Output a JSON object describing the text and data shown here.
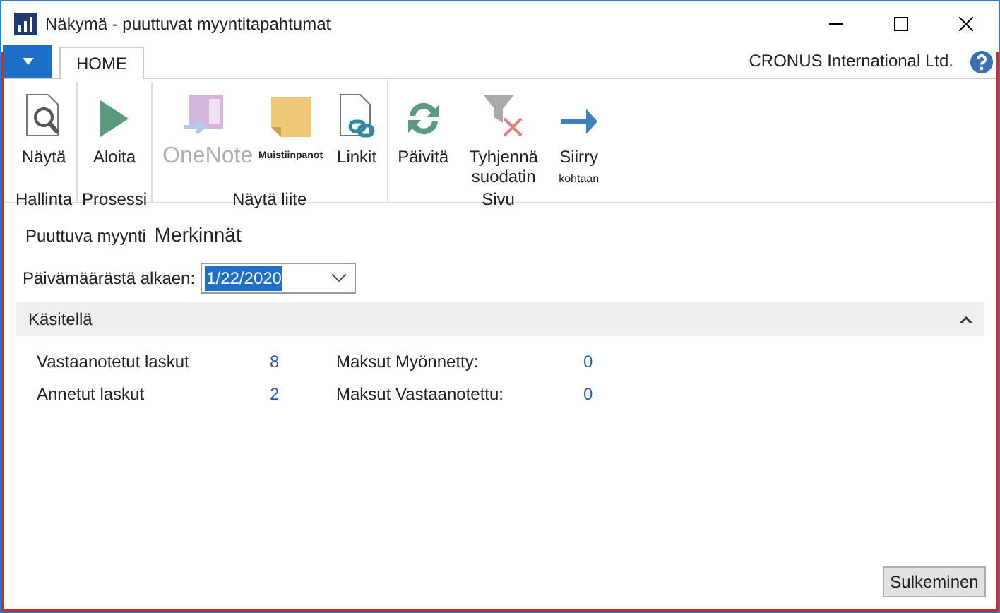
{
  "window": {
    "title": "Näkymä - puuttuvat myyntitapahtumat"
  },
  "tabs": [
    {
      "label": "HOME",
      "selected": true
    }
  ],
  "company": "CRONUS International Ltd.",
  "ribbon_groups": [
    {
      "label": "Hallinta",
      "buttons": [
        {
          "label": "Näytä",
          "kind": "view",
          "disabled": false
        }
      ]
    },
    {
      "label": "Prosessi",
      "buttons": [
        {
          "label": "Aloita",
          "kind": "play",
          "disabled": false
        }
      ]
    },
    {
      "label": "Näytä liite",
      "buttons": [
        {
          "label": "OneNote",
          "kind": "onenote",
          "disabled": true
        },
        {
          "label": "Muistiinpanot",
          "kind": "note",
          "disabled": false
        },
        {
          "label": "Linkit",
          "kind": "link",
          "disabled": false
        }
      ]
    },
    {
      "label": "Sivu",
      "buttons": [
        {
          "label": "Päivitä",
          "kind": "refresh",
          "disabled": false
        },
        {
          "label": "Tyhjennä suodatin",
          "kind": "filter",
          "disabled": false
        },
        {
          "label": "Siirry",
          "sublabel": "kohtaan",
          "kind": "arrow",
          "disabled": false
        }
      ]
    }
  ],
  "heading": {
    "caption": "Puuttuva myynti",
    "title": "Merkinnät"
  },
  "date_field": {
    "label": "Päivämäärästä alkaen:",
    "value": "1/22/2020"
  },
  "section": {
    "title": "Käsitellä",
    "expanded": true,
    "left": [
      {
        "label": "Vastaanotetut laskut",
        "value": "8"
      },
      {
        "label": "Annetut laskut",
        "value": "2"
      }
    ],
    "right": [
      {
        "label": "Maksut Myönnetty:",
        "value": "0"
      },
      {
        "label": "Maksut Vastaanotettu:",
        "value": "0"
      }
    ]
  },
  "close_button": "Sulkeminen"
}
